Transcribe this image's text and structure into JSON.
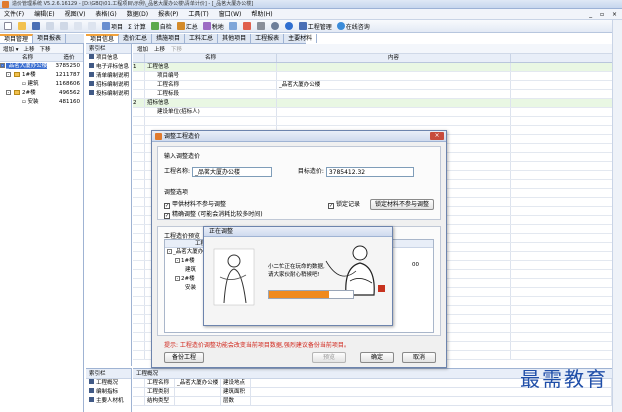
{
  "window": {
    "title": "造价管理系统 V5.2.6.16129 - [D:\\GBQ\\01.工程项目\\示例\\_品茗大厦办公楼\\清单计价] - [_品茗大厦办公楼]",
    "controls": "_ ▫ ×"
  },
  "menu": [
    "文件(F)",
    "编辑(E)",
    "视图(V)",
    "表格(G)",
    "数据(D)",
    "报表(P)",
    "工具(T)",
    "窗口(W)",
    "帮助(H)"
  ],
  "toolbar": {
    "project": "项目",
    "calc": "Σ 计算",
    "check": "自检",
    "total": "汇总",
    "tax": "税地",
    "manage": "工程管理",
    "consult": "在线咨询"
  },
  "left_tabs": [
    "项目管理",
    "项目报表"
  ],
  "project_tree": {
    "toolbar": [
      "增加 ▾",
      "上移",
      "下移"
    ],
    "col_name": "名称",
    "col_price": "造价",
    "rows": [
      {
        "name": "_品茗大厦办公楼",
        "value": "3785250",
        "level": 0,
        "selected": true
      },
      {
        "name": "1#楼",
        "value": "1211787",
        "level": 1
      },
      {
        "name": "建筑",
        "value": "1168606",
        "level": 2
      },
      {
        "name": "2#楼",
        "value": "496562",
        "level": 1
      },
      {
        "name": "安装",
        "value": "481160",
        "level": 2
      }
    ]
  },
  "mid_tabs": [
    "项目信息",
    "造价汇总",
    "措施项目",
    "工料汇总",
    "其他项目",
    "工程报表",
    "主要材料"
  ],
  "index_panel": {
    "caption": "索引栏",
    "items": [
      "项目信息",
      "电子评标信息",
      "清单编制说明",
      "招标编制说明",
      "投标编制说明"
    ]
  },
  "grid": {
    "toolbar": [
      "增加",
      "上移",
      "下移"
    ],
    "col_name": "名称",
    "col_content": "内容",
    "rows": [
      {
        "num": "1",
        "name": "工程信息",
        "content": "",
        "group": true
      },
      {
        "num": "",
        "name": "项目编号",
        "content": "",
        "group": false
      },
      {
        "num": "",
        "name": "工程名称",
        "content": "_品茗大厦办公楼",
        "group": false
      },
      {
        "num": "",
        "name": "工程标段",
        "content": "",
        "group": false
      },
      {
        "num": "2",
        "name": "招标信息",
        "content": "",
        "group": true
      },
      {
        "num": "",
        "name": "建设单位(招标人)",
        "content": "",
        "group": false
      },
      {
        "num": "",
        "name": "",
        "content": "",
        "group": false
      },
      {
        "num": "",
        "name": "",
        "content": "",
        "group": false
      },
      {
        "num": "",
        "name": "",
        "content": "",
        "group": false
      },
      {
        "num": "",
        "name": "",
        "content": "",
        "group": false
      },
      {
        "num": "",
        "name": "",
        "content": "",
        "group": false
      },
      {
        "num": "",
        "name": "",
        "content": "",
        "group": false
      },
      {
        "num": "",
        "name": "",
        "content": "",
        "group": false
      },
      {
        "num": "",
        "name": "",
        "content": "",
        "group": false
      },
      {
        "num": "",
        "name": "",
        "content": "",
        "group": false
      },
      {
        "num": "",
        "name": "",
        "content": "",
        "group": false
      },
      {
        "num": "",
        "name": "",
        "content": "",
        "group": false
      },
      {
        "num": "",
        "name": "",
        "content": "",
        "group": false
      },
      {
        "num": "",
        "name": "",
        "content": "",
        "group": false
      },
      {
        "num": "",
        "name": "",
        "content": "",
        "group": false
      },
      {
        "num": "",
        "name": "",
        "content": "",
        "group": false
      },
      {
        "num": "",
        "name": "",
        "content": "",
        "group": false
      },
      {
        "num": "",
        "name": "",
        "content": "",
        "group": false
      },
      {
        "num": "",
        "name": "",
        "content": "",
        "group": false
      },
      {
        "num": "",
        "name": "",
        "content": "",
        "group": false
      },
      {
        "num": "",
        "name": "",
        "content": "",
        "group": false
      },
      {
        "num": "",
        "name": "",
        "content": "",
        "group": false
      },
      {
        "num": "",
        "name": "",
        "content": "",
        "group": false
      },
      {
        "num": "",
        "name": "",
        "content": "",
        "group": false
      },
      {
        "num": "",
        "name": "",
        "content": "",
        "group": false
      },
      {
        "num": "",
        "name": "",
        "content": "",
        "group": false
      },
      {
        "num": "",
        "name": "",
        "content": "",
        "group": false
      },
      {
        "num": "",
        "name": "",
        "content": "",
        "group": false
      }
    ]
  },
  "bottom_index": {
    "caption": "索引栏",
    "items": [
      "工程概况",
      "编制指标",
      "主要人材机"
    ]
  },
  "bottom_info": {
    "caption": "工程概况",
    "rows": [
      [
        "工程名称",
        "_品茗大厦办公楼",
        "建设地点",
        ""
      ],
      [
        "工程类别",
        "",
        "建筑面积",
        ""
      ],
      [
        "结构类型",
        "",
        "层数",
        ""
      ]
    ]
  },
  "dialog": {
    "title": "调整工程造价",
    "section_input": "输入调整造价",
    "project_name_label": "工程名称:",
    "project_name_value": "_品茗大厦办公楼",
    "target_price_label": "目标造价:",
    "target_price_value": "3785412.32",
    "section_options": "调整选项",
    "opt1": "甲供材料不参与调整",
    "opt2": "精确调整 (可能会消耗比较多时间)",
    "opt3": "锁定记录",
    "lock_btn": "锁定材料不参与调整",
    "section_preview": "工程造价预览",
    "tree_col_name": "工程",
    "preview_tree": [
      "_品茗大厦办公",
      "1#楼",
      "建筑",
      "2#楼",
      "安装"
    ],
    "preview_values": [
      "",
      "",
      "",
      "",
      ""
    ],
    "preview_side_value": "00",
    "hint": "提示: 工程造价调整功能会改变当前项目数据,强烈建议备份当前项目。",
    "backup_btn": "备份工程",
    "preview_btn": "预览",
    "ok_btn": "确定",
    "cancel_btn": "取消"
  },
  "progress": {
    "title": "正在调整",
    "message_line1": "小二忙正在玩命的数据,",
    "message_line2": "请大家伙耐心稍候吧!",
    "percent": 0.71,
    "stamp": "品茗"
  },
  "watermark": "最需教育",
  "colors": {
    "accent": "#f08a1e",
    "selection": "#3b6fd1",
    "group_row": "#e9f7e3",
    "hint": "#d1261b"
  }
}
